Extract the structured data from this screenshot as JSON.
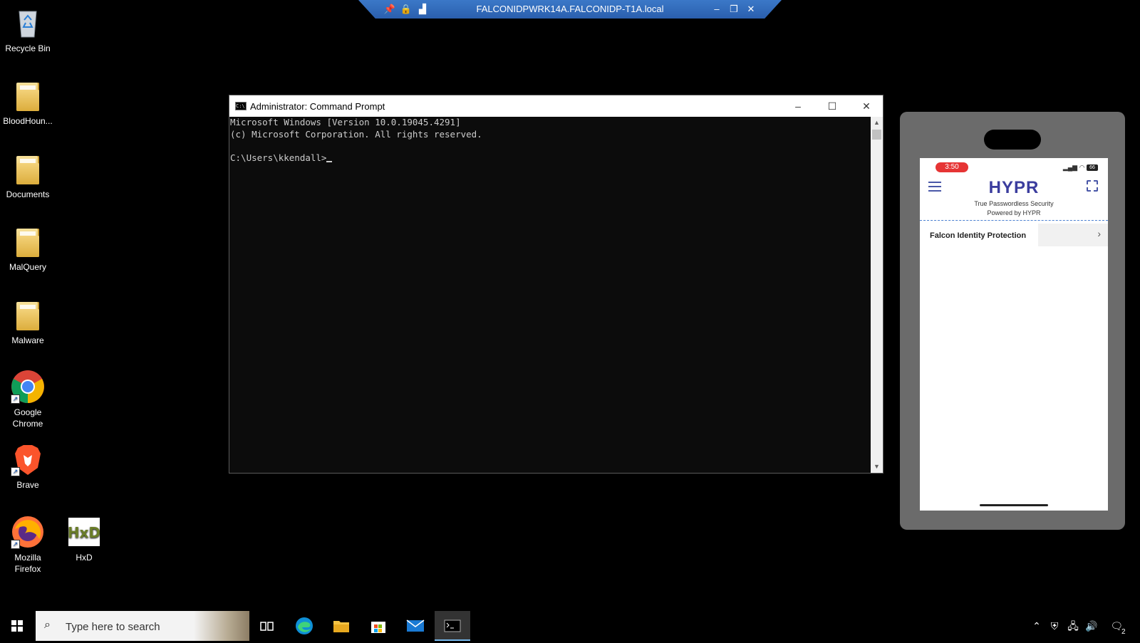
{
  "desktop": {
    "icons": [
      {
        "label": "Recycle Bin"
      },
      {
        "label": "BloodHoun..."
      },
      {
        "label": "Documents"
      },
      {
        "label": "MalQuery"
      },
      {
        "label": "Malware"
      },
      {
        "label": "Google Chrome"
      },
      {
        "label": "Brave"
      },
      {
        "label": "Mozilla Firefox"
      },
      {
        "label": "HxD"
      }
    ]
  },
  "rdp_bar": {
    "title": "FALCONIDPWRK14A.FALCONIDP-T1A.local",
    "icons": [
      "pin-icon",
      "lock-icon",
      "signal-icon",
      "minimize-icon",
      "restore-icon",
      "close-icon"
    ]
  },
  "cmd": {
    "title": "Administrator: Command Prompt",
    "line1": "Microsoft Windows [Version 10.0.19045.4291]",
    "line2": "(c) Microsoft Corporation. All rights reserved.",
    "prompt": "C:\\Users\\kkendall>"
  },
  "phone": {
    "time": "3:50",
    "battery": "66",
    "brand": "HYPR",
    "tagline1": "True Passwordless Security",
    "tagline2": "Powered by HYPR",
    "list_item": "Falcon Identity Protection"
  },
  "taskbar": {
    "search_placeholder": "Type here to search",
    "apps": [
      "task-view",
      "edge",
      "file-explorer",
      "store",
      "mail",
      "command-prompt"
    ],
    "notification_count": "2"
  },
  "colors": {
    "rdp_bar": "#2f6bbd",
    "hypr_brand": "#3b3d9e",
    "time_pill": "#e63434",
    "active_task_underline": "#76b9ed"
  }
}
